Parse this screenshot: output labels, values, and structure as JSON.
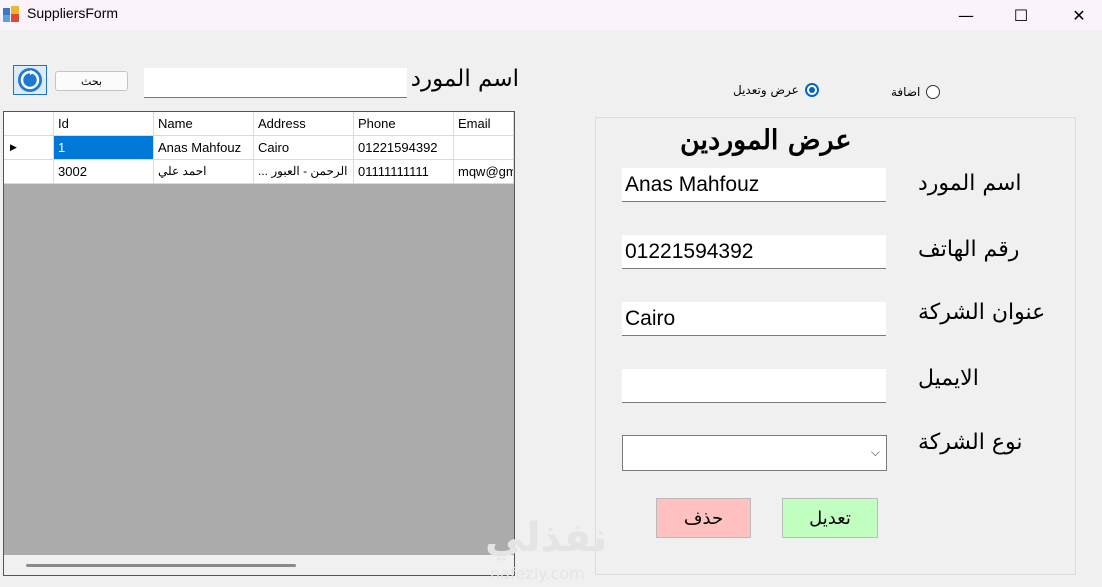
{
  "window": {
    "title": "SuppliersForm",
    "minimize": "—",
    "maximize": "☐",
    "close": "✕"
  },
  "search": {
    "button_label": "بحث",
    "label": "اسم المورد",
    "value": ""
  },
  "mode": {
    "view_edit_label": "عرض وتعديل",
    "add_label": "اضافة",
    "selected": "view_edit"
  },
  "grid": {
    "columns": [
      "Id",
      "Name",
      "Address",
      "Phone",
      "Email"
    ],
    "rows": [
      {
        "marker": "▶",
        "id": "1",
        "name": "Anas Mahfouz",
        "address": "Cairo",
        "phone": "01221594392",
        "email": ""
      },
      {
        "marker": "",
        "id": "3002",
        "name": "احمد علي",
        "address": "... الرحمن - العبور",
        "phone": "01111111111",
        "email": "mqw@gm"
      }
    ]
  },
  "form": {
    "title": "عرض الموردين",
    "name_label": "اسم المورد",
    "name_value": "Anas Mahfouz",
    "phone_label": "رقم الهاتف",
    "phone_value": "01221594392",
    "address_label": "عنوان الشركة",
    "address_value": "Cairo",
    "email_label": "الايميل",
    "email_value": "",
    "type_label": "نوع الشركة",
    "type_value": "",
    "delete_label": "حذف",
    "edit_label": "تعديل"
  },
  "watermark": {
    "arabic": "نفذلي",
    "latin": "nafezly.com"
  },
  "colors": {
    "selection": "#0078d7",
    "delete": "#ffc0c0",
    "edit": "#c0ffc0",
    "radio_accent": "#0067c0"
  }
}
